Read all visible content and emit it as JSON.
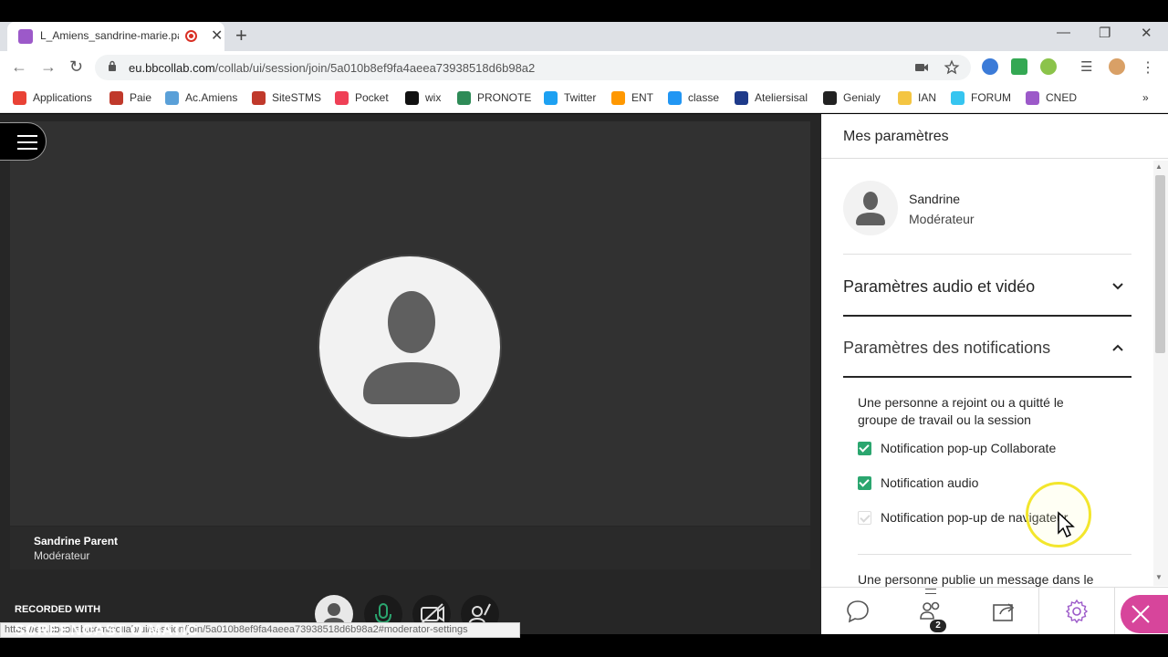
{
  "browser": {
    "tab_title": "L_Amiens_sandrine-marie.pa",
    "url_host": "eu.bbcollab.com",
    "url_path": "/collab/ui/session/join/5a010b8ef9fa4aeea73938518d6b98a2",
    "status_url": "https://eu.bbcollab.com/collab/ui/session/join/5a010b8ef9fa4aeea73938518d6b98a2#moderator-settings",
    "bookmarks": [
      {
        "label": "Applications",
        "color": "#e94235"
      },
      {
        "label": "Paie",
        "color": "#c0392b"
      },
      {
        "label": "Ac.Amiens",
        "color": "#5aa0d8"
      },
      {
        "label": "SiteSTMS",
        "color": "#c0392b"
      },
      {
        "label": "Pocket",
        "color": "#ef4056"
      },
      {
        "label": "wix",
        "color": "#111111"
      },
      {
        "label": "PRONOTE",
        "color": "#2e8b57"
      },
      {
        "label": "Twitter",
        "color": "#1da1f2"
      },
      {
        "label": "ENT",
        "color": "#ff9800"
      },
      {
        "label": "classe",
        "color": "#2196f3"
      },
      {
        "label": "Ateliersisal",
        "color": "#1e3a8a"
      },
      {
        "label": "Genialy",
        "color": "#222222"
      },
      {
        "label": "IAN",
        "color": "#f4c542"
      },
      {
        "label": "FORUM",
        "color": "#36c5f0"
      },
      {
        "label": "CNED",
        "color": "#9c59c9"
      }
    ],
    "more_bookmarks": "»"
  },
  "stage": {
    "participant_name": "Sandrine Parent",
    "participant_role": "Modérateur",
    "recorded_with": "RECORDED WITH",
    "screencast_logo": "SCREENCAST O MATIC"
  },
  "panel": {
    "title": "Mes paramètres",
    "user_name": "Sandrine",
    "user_role": "Modérateur",
    "section_audio_video": "Paramètres audio et vidéo",
    "section_notifications": "Paramètres des notifications",
    "notif_description": "Une personne a rejoint ou a quitté le groupe de travail ou la session",
    "checkboxes": [
      {
        "label": "Notification pop-up Collaborate",
        "checked": true
      },
      {
        "label": "Notification audio",
        "checked": true
      },
      {
        "label": "Notification pop-up de navigateur",
        "checked": false
      }
    ],
    "second_description": "Une personne publie un message dans le",
    "attendees_badge": "2"
  },
  "colors": {
    "accent_green": "#2ba66f",
    "close_pink": "#d7459b",
    "stage_bg": "#262626"
  }
}
